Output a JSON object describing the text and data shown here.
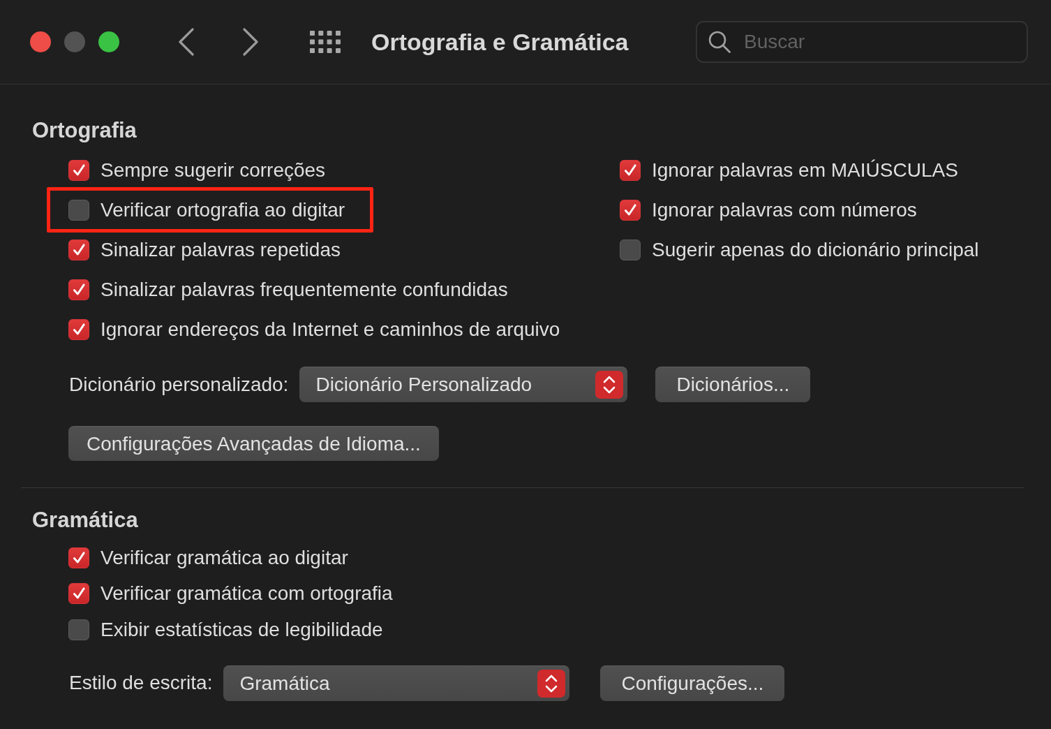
{
  "window": {
    "title": "Ortografia e Gramática",
    "controls": [
      {
        "kind": "close",
        "disabled": false
      },
      {
        "kind": "minimize",
        "disabled": true
      },
      {
        "kind": "zoom",
        "disabled": false
      }
    ]
  },
  "search": {
    "placeholder": "Buscar"
  },
  "spelling": {
    "heading": "Ortografia",
    "columns": [
      {
        "options": [
          {
            "label": "Sempre sugerir correções",
            "checked": true,
            "highlighted": false
          },
          {
            "label": "Verificar ortografia ao digitar",
            "checked": false,
            "highlighted": true
          },
          {
            "label": "Sinalizar palavras repetidas",
            "checked": true,
            "highlighted": false
          },
          {
            "label": "Sinalizar palavras frequentemente confundidas",
            "checked": true,
            "highlighted": false
          },
          {
            "label": "Ignorar endereços da Internet e caminhos de arquivo",
            "checked": true,
            "highlighted": false
          }
        ]
      },
      {
        "options": [
          {
            "label": "Ignorar palavras em MAIÚSCULAS",
            "checked": true,
            "highlighted": false
          },
          {
            "label": "Ignorar palavras com números",
            "checked": true,
            "highlighted": false
          },
          {
            "label": "Sugerir apenas do dicionário principal",
            "checked": false,
            "highlighted": false
          }
        ]
      }
    ],
    "dictionary": {
      "label": "Dicionário personalizado:",
      "value": "Dicionário Personalizado",
      "button": "Dicionários..."
    },
    "advanced_button": "Configurações Avançadas de Idioma..."
  },
  "grammar": {
    "heading": "Gramática",
    "options": [
      {
        "label": "Verificar gramática ao digitar",
        "checked": true,
        "highlighted": false
      },
      {
        "label": "Verificar gramática com ortografia",
        "checked": true,
        "highlighted": false
      },
      {
        "label": "Exibir estatísticas de legibilidade",
        "checked": false,
        "highlighted": false
      }
    ],
    "writing_style": {
      "label": "Estilo de escrita:",
      "value": "Gramática",
      "button": "Configurações..."
    }
  }
}
